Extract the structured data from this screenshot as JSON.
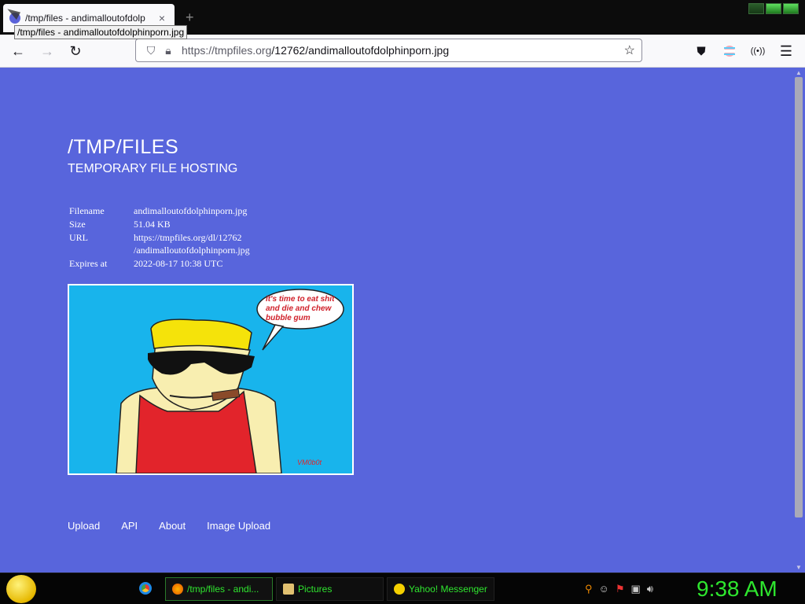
{
  "browser": {
    "tab_title": "/tmp/files - andimalloutofdolp",
    "tooltip": "/tmp/files - andimalloutofdolphinporn.jpg",
    "url_host": "https://tmpfiles.org",
    "url_path": "/12762/andimalloutofdolphinporn.jpg",
    "new_tab_icon": "+",
    "close_tab_icon": "×"
  },
  "page": {
    "title": "/TMP/FILES",
    "subtitle": "TEMPORARY FILE HOSTING",
    "info": [
      {
        "label": "Filename",
        "value": "andimalloutofdolphinporn.jpg"
      },
      {
        "label": "Size",
        "value": "51.04 KB"
      },
      {
        "label": "URL",
        "value": "https://tmpfiles.org/dl/12762",
        "value2": "/andimalloutofdolphinporn.jpg"
      },
      {
        "label": "Expires at",
        "value": "2022-08-17 10:38 UTC"
      }
    ],
    "image": {
      "speech_line1": "it's time to eat shit",
      "speech_line2": "and die and chew",
      "speech_line3": "bubble gum",
      "signature": "VM0b0t"
    },
    "footer": [
      "Upload",
      "API",
      "About",
      "Image Upload"
    ],
    "background_color": "#5865dc"
  },
  "taskbar": {
    "buttons": [
      {
        "label": "/tmp/files - andi...",
        "icon": "firefox-icon"
      },
      {
        "label": "Pictures",
        "icon": "folder-icon"
      },
      {
        "label": "Yahoo! Messenger",
        "icon": "smiley-icon"
      }
    ],
    "clock": "9:38 AM",
    "accent_color": "#2ee62e"
  }
}
